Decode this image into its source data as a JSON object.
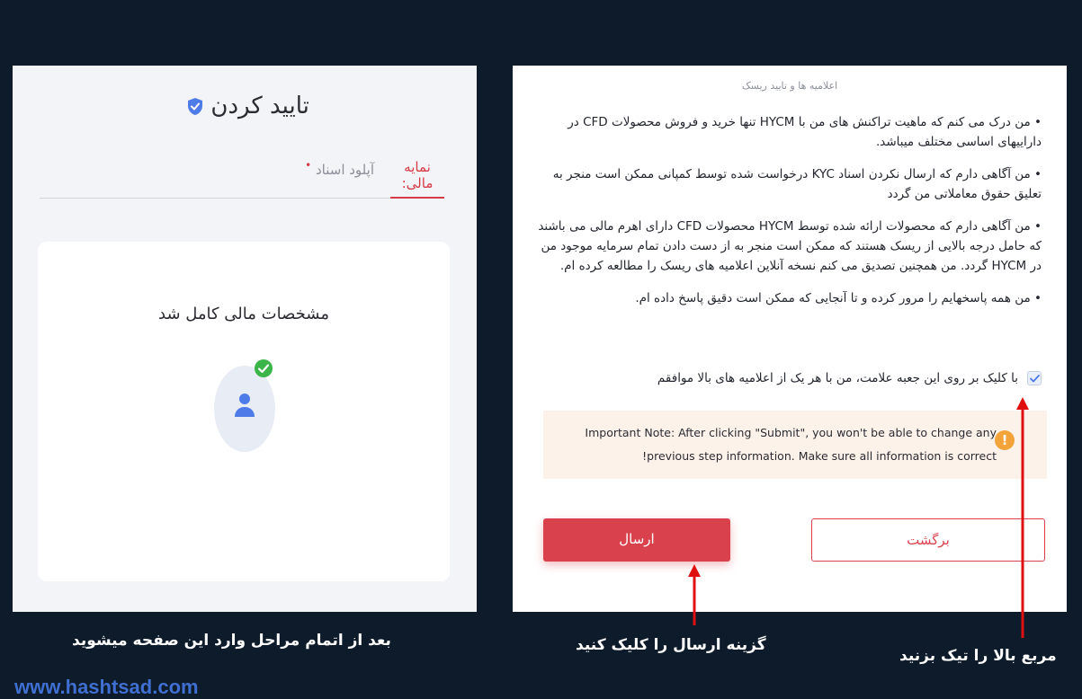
{
  "verify_panel": {
    "title": "تایید کردن",
    "tabs": [
      {
        "label": "نمایه مالی:"
      },
      {
        "label": "آپلود اسناد"
      }
    ],
    "required_marker": "•",
    "card_title": "مشخصات مالی کامل شد"
  },
  "risk_panel": {
    "section_label": "اعلامیه ها و تایید ریسک",
    "bullets": [
      "• من درک می کنم که ماهیت تراکنش های من با HYCM تنها خرید و فروش محصولات CFD در داراییهای اساسی مختلف میباشد.",
      "• من آگاهی دارم که ارسال نکردن اسناد KYC درخواست شده توسط کمپانی ممکن است منجر به تعلیق حقوق معاملاتی من گردد",
      "• من آگاهی دارم که محصولات ارائه شده توسط HYCM محصولات CFD دارای اهرم مالی می باشند که حامل درجه بالایی از ریسک هستند که ممکن است منجر به از دست دادن تمام سرمایه موجود من در HYCM گردد. من همچنین تصدیق می کنم نسخه آنلاین اعلامیه های ریسک را مطالعه کرده ام.",
      "• من همه پاسخهایم را مرور کرده و تا آنجایی که ممکن است دقیق پاسخ داده ام."
    ],
    "agree_label": "با کلیک بر روی این جعبه علامت، من با هر یک از اعلامیه های بالا موافقم",
    "agree_checked": true,
    "note_line1": "Important Note: After clicking \"Submit\", you won't be able to change any",
    "note_line2": "!previous step information. Make sure all information is correct",
    "note_icon": "!",
    "submit_label": "ارسال",
    "back_label": "برگشت"
  },
  "annotations": {
    "left_caption": "بعد از اتمام مراحل وارد این صفحه میشوید",
    "mid_caption": "گزینه ارسال را کلیک کنید",
    "right_caption": "مربع بالا را تیک بزنید",
    "arrow_color": "#e01010"
  },
  "watermark": "www.hashtsad.com",
  "colors": {
    "background": "#0d1b2b",
    "accent_red": "#d9424d",
    "note_bg": "#fdf2e9",
    "warning_orange": "#f2a33a",
    "success_green": "#3bb54a",
    "shield_blue": "#4f7be8"
  }
}
